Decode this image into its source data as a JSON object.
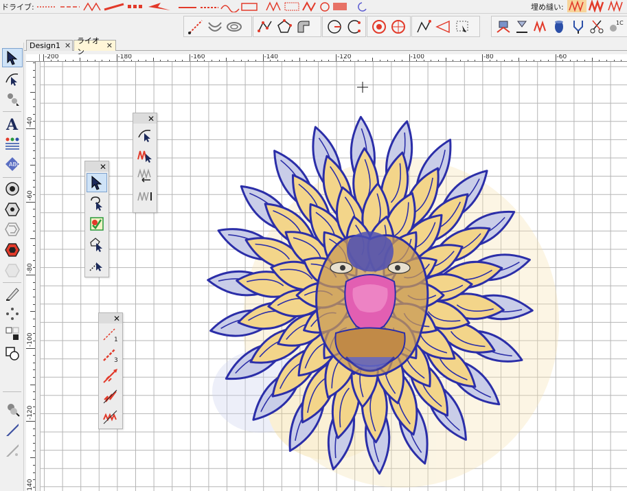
{
  "toolbar_top": {
    "style_label": "ドライブ:",
    "fill_label": "埋め縫い:"
  },
  "tabs": [
    {
      "label": "Design1",
      "active": false
    },
    {
      "label": "ライオン",
      "active": true
    }
  ],
  "ruler": {
    "h_labels": [
      "-200",
      "-180",
      "-160",
      "-140",
      "-120",
      "-100",
      "-80",
      "-60"
    ],
    "v_labels": [
      "-40",
      "-60",
      "-80",
      "-100",
      "-120",
      "-140"
    ]
  },
  "floating_toolbars": [
    {
      "name": "floating-toolbar-select",
      "close": "✕"
    },
    {
      "name": "floating-toolbar-reshape",
      "close": "✕"
    },
    {
      "name": "floating-toolbar-run",
      "close": "✕"
    }
  ],
  "colors": {
    "outline": "#2b2ea8",
    "mane_fill": "#f3d58a",
    "shadow_fill": "#c9cde8",
    "face_fill": "#c79a5a",
    "nose_fill": "#e25fb2",
    "accent_red": "#e23a2a",
    "grid": "#b5b5b5"
  },
  "icons": {
    "left_toolbar": [
      "arrow-select-icon",
      "reshape-icon",
      "node-icon",
      "text-icon",
      "monogram-icon",
      "badge-icon",
      "circle-target-icon",
      "hexagon-icon",
      "spiral-icon",
      "hexagon-red-icon",
      "hexagon-gray-icon",
      "knife-icon",
      "dots-icon",
      "grid-icon",
      "shape-combine-icon",
      "bead-icon",
      "needle-icon",
      "needle-gray-icon"
    ]
  }
}
